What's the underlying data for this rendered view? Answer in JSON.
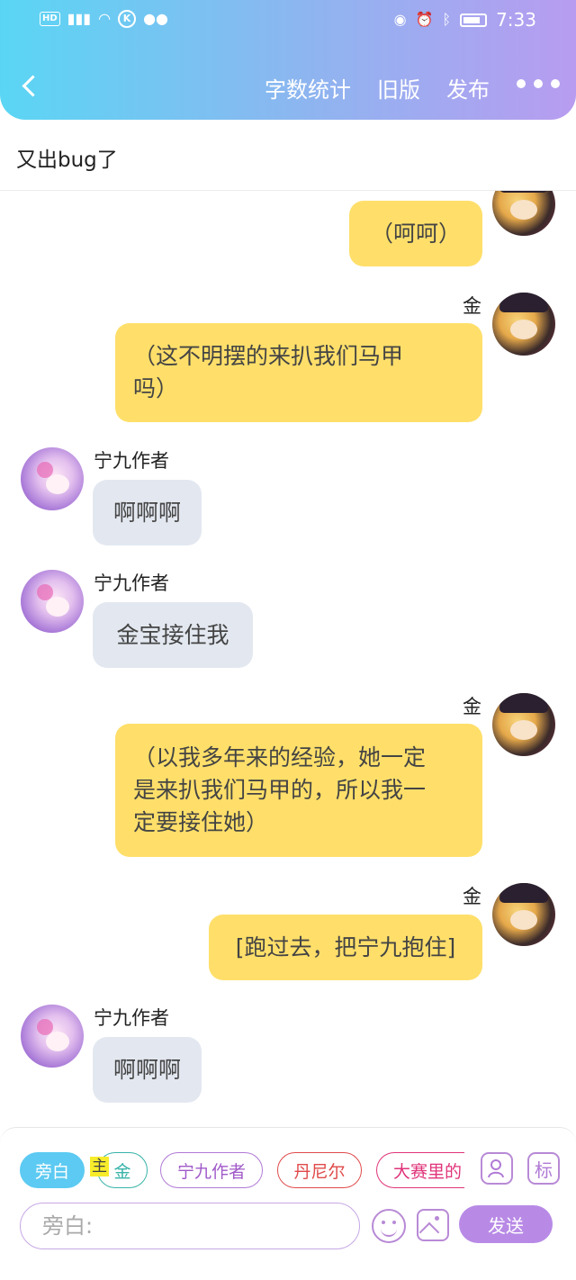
{
  "status_bar": {
    "left_icons": [
      "hd-icon",
      "signal-4g-icon",
      "wifi-icon",
      "k-app-icon",
      "wechat-icon"
    ],
    "right_icons": [
      "eye-icon",
      "alarm-icon",
      "bluetooth-icon",
      "battery-icon"
    ],
    "time": "7:33"
  },
  "nav": {
    "word_count": "字数统计",
    "old_version": "旧版",
    "publish": "发布"
  },
  "title": "又出bug了",
  "messages": [
    {
      "role": "me",
      "name": "",
      "text": "（呵呵）"
    },
    {
      "role": "me",
      "name": "金",
      "line1": "（这不明摆的来扒我们马甲",
      "line2": "吗）"
    },
    {
      "role": "other",
      "name": "宁九作者",
      "text": "啊啊啊"
    },
    {
      "role": "other",
      "name": "宁九作者",
      "text": "金宝接住我"
    },
    {
      "role": "me",
      "name": "金",
      "line1": "（以我多年来的经验，她一定",
      "line2": "是来扒我们马甲的，所以我一",
      "line3": "定要接住她）"
    },
    {
      "role": "me",
      "name": "金",
      "text": "[跑过去，把宁九抱住]"
    },
    {
      "role": "other",
      "name": "宁九作者",
      "text": "啊啊啊"
    }
  ],
  "composer": {
    "chips": [
      "旁白",
      "金",
      "宁九作者",
      "丹尼尔",
      "大赛里的"
    ],
    "main_tag": "主",
    "tag_button": "标",
    "placeholder": "旁白:",
    "send": "发送"
  },
  "colors": {
    "my_bubble": "#ffdf6a",
    "other_bubble": "#e3e8f0",
    "accent": "#b88ae6",
    "narrator_chip": "#5ccaf2"
  }
}
